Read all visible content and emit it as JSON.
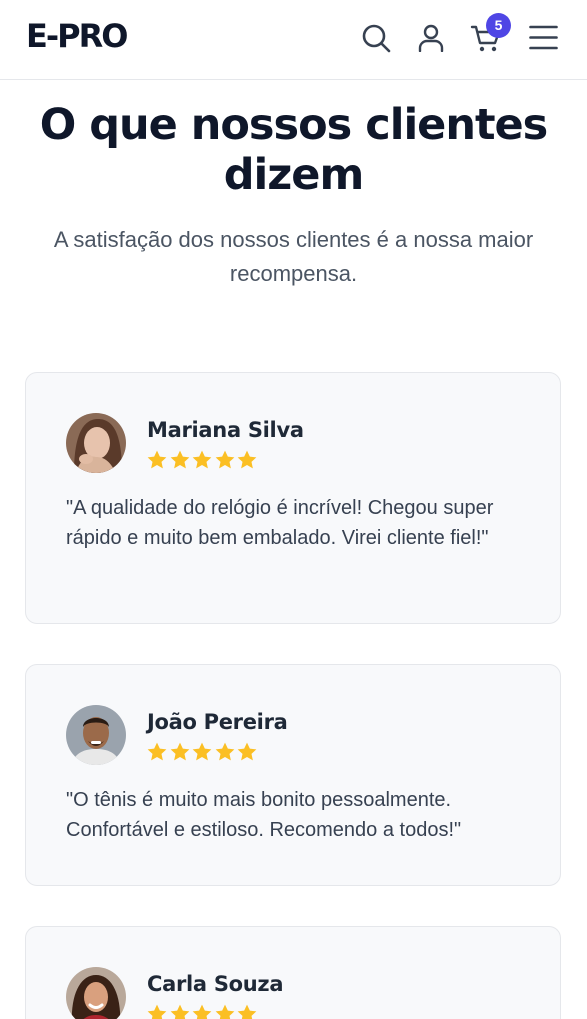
{
  "header": {
    "logo": "E-PRO",
    "cart_count": "5",
    "icons": [
      "search-icon",
      "user-icon",
      "cart-icon",
      "menu-icon"
    ]
  },
  "section": {
    "title": "O que nossos clientes dizem",
    "subtitle": "A satisfação dos nossos clientes é a nossa maior recompensa."
  },
  "testimonials": [
    {
      "name": "Mariana Silva",
      "rating": 5,
      "quote": "\"A qualidade do relógio é incrível! Chegou super rápido e muito bem embalado. Virei cliente fiel!\""
    },
    {
      "name": "João Pereira",
      "rating": 5,
      "quote": "\"O tênis é muito mais bonito pessoalmente. Confortável e estiloso. Recomendo a todos!\""
    },
    {
      "name": "Carla Souza",
      "rating": 5,
      "quote": ""
    }
  ],
  "colors": {
    "accent": "#4f46e5",
    "star": "#fbbf24",
    "heading": "#0f172a",
    "card_bg": "#f8f9fb"
  }
}
